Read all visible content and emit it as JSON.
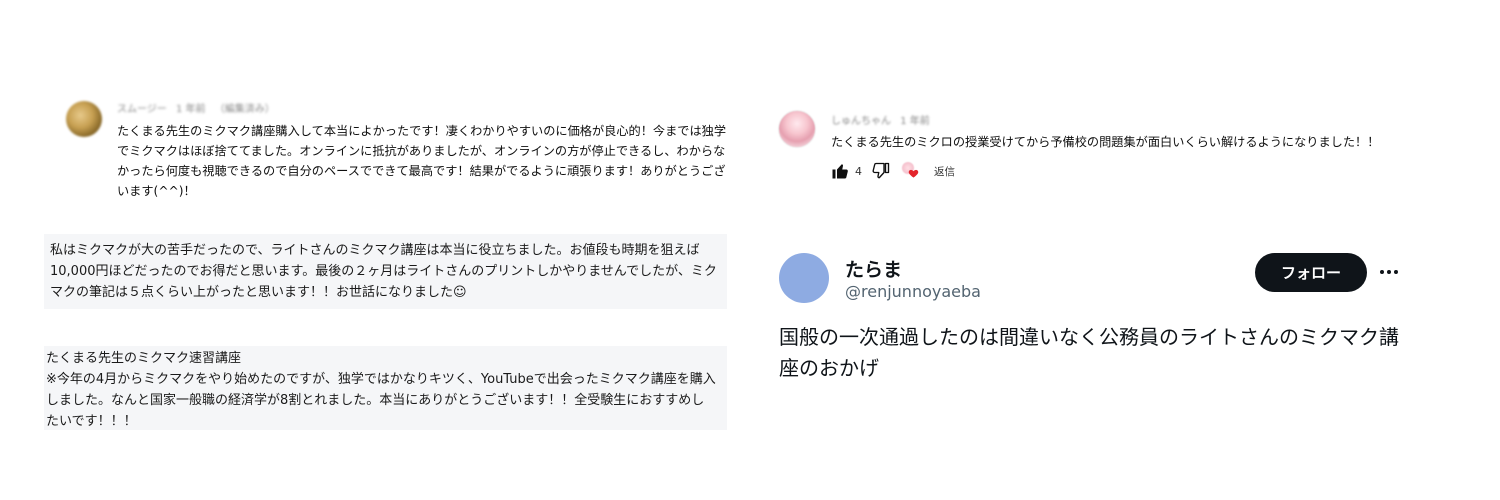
{
  "youtube_comment_1": {
    "author": "スムージー",
    "time": "1 年前",
    "edited": "（編集済み）",
    "text": "たくまる先生のミクマク講座購入して本当によかったです！凄くわかりやすいのに価格が良心的！今までは独学でミクマクはほぼ捨ててました。オンラインに抵抗がありましたが、オンラインの方が停止できるし、わからなかったら何度も視聴できるので自分のペースでできて最高です！結果がでるように頑張ります！ありがとうございます(^^)！"
  },
  "review_card_1": {
    "text": "私はミクマクが大の苦手だったので、ライトさんのミクマク講座は本当に役立ちました。お値段も時期を狙えば10,000円ほどだったのでお得だと思います。最後の２ヶ月はライトさんのプリントしかやりませんでしたが、ミクマクの筆記は５点くらい上がったと思います！！お世話になりました☺"
  },
  "review_card_2": {
    "title": "たくまる先生のミクマク速習講座",
    "text": "※今年の4月からミクマクをやり始めたのですが、独学ではかなりキツく、YouTubeで出会ったミクマク講座を購入しました。なんと国家一般職の経済学が8割とれました。本当にありがとうございます！！全受験生におすすめしたいです！！！"
  },
  "youtube_comment_2": {
    "author": "しゅんちゃん",
    "time": "1 年前",
    "text": "たくまる先生のミクロの授業受けてから予備校の問題集が面白いくらい解けるようになりました！！",
    "like_count": "4",
    "reply_label": "返信",
    "icons": [
      "thumbs-up-icon",
      "thumbs-down-icon",
      "creator-heart-icon"
    ]
  },
  "tweet": {
    "display_name": "たらま",
    "handle": "@renjunnoyaeba",
    "follow_label": "フォロー",
    "text": "国般の一次通過したのは間違いなく公務員のライトさんのミクマク講座のおかげ",
    "avatar_color": "#8eabe2"
  }
}
